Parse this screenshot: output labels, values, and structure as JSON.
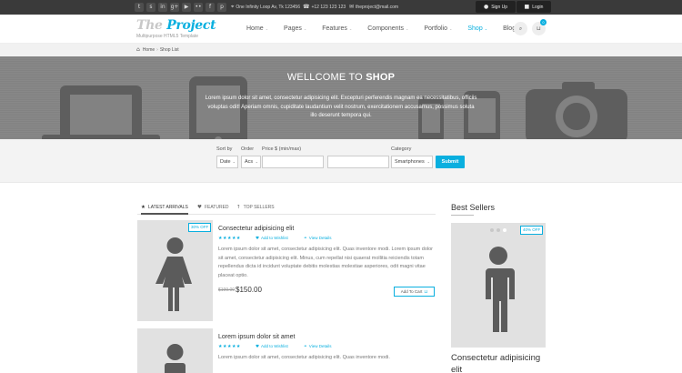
{
  "topbar": {
    "social_icons": [
      "twitter-icon",
      "skype-icon",
      "linkedin-icon",
      "google-plus-icon",
      "youtube-icon",
      "flickr-icon",
      "facebook-icon",
      "pinterest-icon"
    ],
    "social_glyphs": [
      "t",
      "s",
      "in",
      "g+",
      "▶",
      "••",
      "f",
      "p"
    ],
    "address": "One Infinity Loop Av, Tk 123456",
    "phone": "+12 123 123 123",
    "email": "theproject@mail.com",
    "signup_label": "Sign Up",
    "login_label": "Login"
  },
  "header": {
    "logo_the": "The",
    "logo_project": "Project",
    "tagline": "Multipurpose HTML5 Template",
    "nav": [
      {
        "label": "Home",
        "active": false
      },
      {
        "label": "Pages",
        "active": false
      },
      {
        "label": "Features",
        "active": false
      },
      {
        "label": "Components",
        "active": false
      },
      {
        "label": "Portfolio",
        "active": false
      },
      {
        "label": "Shop",
        "active": true
      },
      {
        "label": "Blog",
        "active": false
      }
    ],
    "cart_count": "0"
  },
  "breadcrumb": {
    "home": "Home",
    "current": "Shop List"
  },
  "hero": {
    "title_prefix": "WELLCOME TO",
    "title_bold": "SHOP",
    "text": "Lorem ipsum dolor sit amet, consectetur adipisicing elit. Excepturi perferendis magnam ea necessitatibus, officiis voluptas odit! Aperiam omnis, cupiditate laudantium velit nostrum, exercitationem accusamus, possimus soluta illo deserunt tempora qui."
  },
  "filters": {
    "sort_label": "Sort by",
    "sort_value": "Date",
    "order_label": "Order",
    "order_value": "Acs",
    "price_label": "Price $ (min/max)",
    "price_min": "",
    "price_max": "",
    "category_label": "Category",
    "category_value": "Smartphones",
    "submit_label": "Submit"
  },
  "tabs": [
    {
      "label": "LATEST ARRIVALS",
      "icon": "star-icon",
      "active": true
    },
    {
      "label": "FEATURED",
      "icon": "heart-icon",
      "active": false
    },
    {
      "label": "TOP SELLERS",
      "icon": "arrow-up-icon",
      "active": false
    }
  ],
  "products": [
    {
      "title": "Consectetur adipisicing elit",
      "badge": "30% OFF",
      "rating": 5,
      "wishlist_label": "Add to Wishlist",
      "details_label": "View Details",
      "description": "Lorem ipsum dolor sit amet, consectetur adipisicing elit. Quas inventore modi. Lorem ipsum dolor sit amet, consectetur adipisicing elit. Minus, cum repellat nisi quaerat mollitia reiciendis totam repellendus dicta id incidunt voluptate debitis molestias molestiae asperiores, odit magni vitae placeat optio.",
      "old_price": "$199.00",
      "price": "$150.00",
      "add_to_cart_label": "Add To Cart",
      "figure": "female"
    },
    {
      "title": "Lorem ipsum dolor sit amet",
      "rating": 5,
      "wishlist_label": "Add to Wishlist",
      "details_label": "View Details",
      "description": "Lorem ipsum dolor sit amet, consectetur adipisicing elit. Quas inventore modi.",
      "figure": "male"
    }
  ],
  "sidebar": {
    "title": "Best Sellers",
    "badge": "40% OFF",
    "product_title": "Consectetur adipisicing elit"
  },
  "colors": {
    "accent": "#09afdf",
    "topbar": "#3a3a3a",
    "hero": "#828282",
    "placeholder": "#e1e1e1",
    "figure": "#5b5b5b"
  }
}
